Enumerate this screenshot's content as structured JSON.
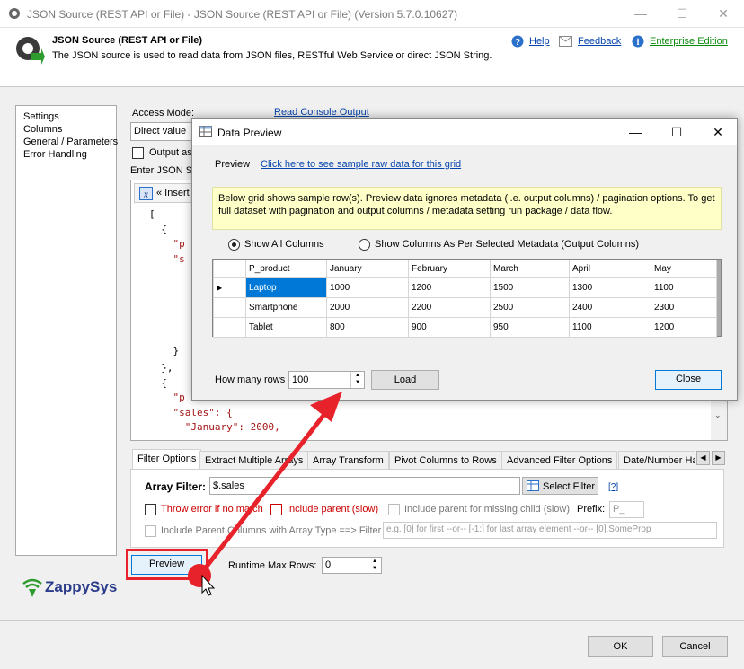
{
  "window": {
    "title": "JSON Source (REST API or File) - JSON Source (REST API or File) (Version 5.7.0.10627)",
    "minimize": "—",
    "maximize": "☐",
    "close": "✕"
  },
  "header": {
    "title": "JSON Source (REST API or File)",
    "description": "The JSON source is used to read data from JSON files, RESTful Web Service or direct JSON String.",
    "help": "Help",
    "feedback": "Feedback",
    "edition": "Enterprise Edition"
  },
  "sidebar": {
    "items": [
      {
        "label": "Settings"
      },
      {
        "label": "Columns"
      },
      {
        "label": "General / Parameters"
      },
      {
        "label": "Error Handling"
      }
    ]
  },
  "settings": {
    "access_mode_label": "Access Mode:",
    "access_mode_value": "Direct value",
    "read_console_output": "Read Console Output",
    "output_as_label": "Output as",
    "enter_json_label": "Enter JSON St",
    "insert_label": "« Insert"
  },
  "code_lines": [
    "[",
    "  {",
    "    \"p",
    "    \"s",
    "    }",
    "  },",
    "  {",
    "    \"p",
    "    \"sales\": {",
    "      \"January\": 2000,"
  ],
  "tabs": [
    {
      "label": "Filter Options"
    },
    {
      "label": "Extract Multiple Arrays"
    },
    {
      "label": "Array Transform"
    },
    {
      "label": "Pivot Columns to Rows"
    },
    {
      "label": "Advanced Filter Options"
    },
    {
      "label": "Date/Number Ha"
    }
  ],
  "filter": {
    "array_filter_label": "Array Filter:",
    "array_filter_value": "$.sales",
    "select_filter": "Select Filter",
    "help_link": "[?]",
    "throw_error": "Throw error if no match",
    "include_parent": "Include parent (slow)",
    "include_parent_missing": "Include parent for missing child (slow)",
    "prefix_label": "Prefix:",
    "prefix_value": "P_",
    "include_parent_columns": "Include Parent Columns with Array Type ==> Filter :",
    "filter_placeholder": "e.g. [0] for first --or-- [-1:] for last array element --or-- [0].SomeProp"
  },
  "bottom": {
    "preview_button": "Preview",
    "runtime_max_rows_label": "Runtime Max Rows:",
    "runtime_max_rows_value": "0",
    "ok": "OK",
    "cancel": "Cancel",
    "brand": "ZappySys"
  },
  "dialog": {
    "title": "Data Preview",
    "minimize": "—",
    "maximize": "☐",
    "close_x": "✕",
    "preview_label": "Preview",
    "sample_link": "Click here to see sample raw data for this grid",
    "info": "Below grid shows sample row(s). Preview data ignores metadata (i.e. output columns) / pagination options. To get full dataset with pagination and output columns / metadata setting run package / data flow.",
    "radio_all": "Show All Columns",
    "radio_meta": "Show Columns As Per Selected Metadata (Output Columns)",
    "grid": {
      "columns": [
        "P_product",
        "January",
        "February",
        "March",
        "April",
        "May"
      ],
      "rows": [
        [
          "Laptop",
          "1000",
          "1200",
          "1500",
          "1300",
          "1100"
        ],
        [
          "Smartphone",
          "2000",
          "2200",
          "2500",
          "2400",
          "2300"
        ],
        [
          "Tablet",
          "800",
          "900",
          "950",
          "1100",
          "1200"
        ]
      ]
    },
    "rows_label": "How many rows",
    "rows_value": "100",
    "load": "Load",
    "close": "Close"
  },
  "colors": {
    "accent_red": "#e8222a",
    "link": "#0645ad",
    "info_bg": "#ffffc8",
    "selection": "#0078d7",
    "edition_green": "#0a8a0a"
  }
}
